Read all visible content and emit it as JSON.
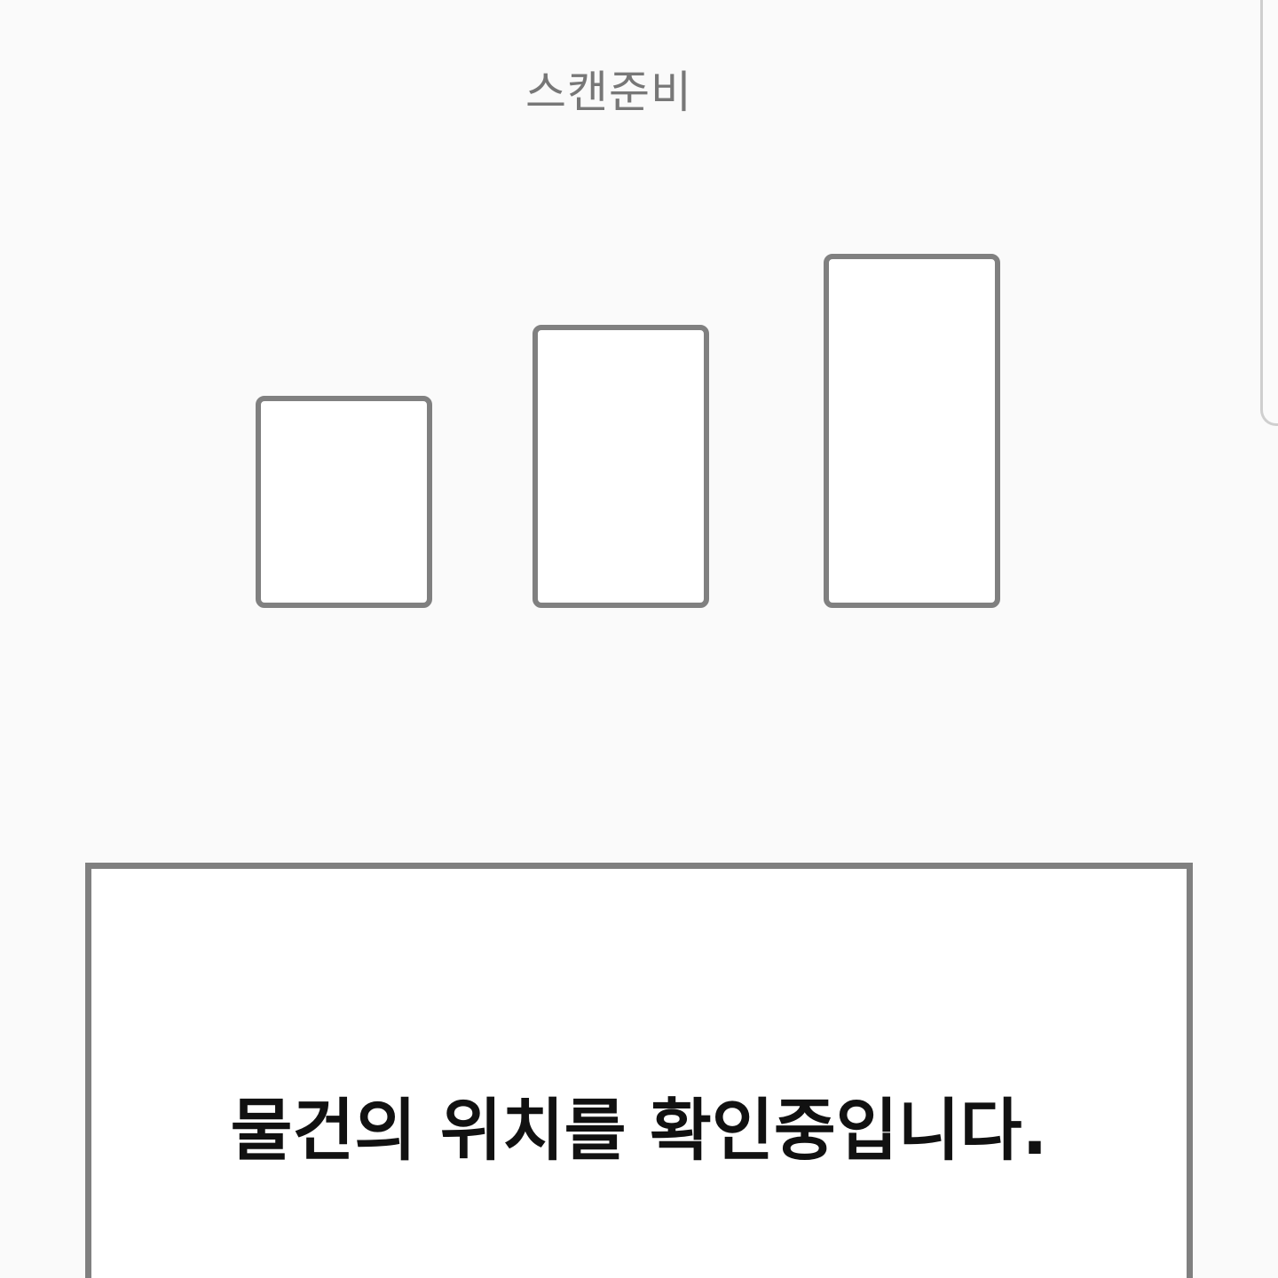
{
  "header": {
    "title": "스캔준비"
  },
  "levels": {
    "icon": "signal-level-boxes"
  },
  "status": {
    "message": "물건의 위치를 확인중입니다."
  },
  "colors": {
    "background": "#fafafa",
    "outline": "#808080",
    "title_text": "#777777",
    "message_text": "#111111"
  }
}
